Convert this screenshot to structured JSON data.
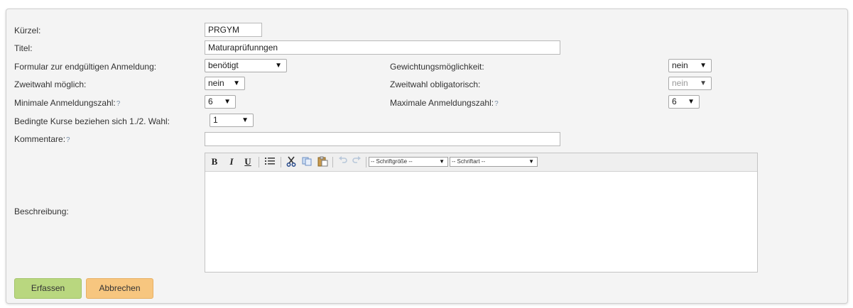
{
  "form": {
    "kuerzel": {
      "label": "Kürzel:",
      "value": "PRGYM"
    },
    "titel": {
      "label": "Titel:",
      "value": "Maturaprüfunngen"
    },
    "formular": {
      "label": "Formular zur endgültigen Anmeldung:",
      "value": "benötigt"
    },
    "gewichtung": {
      "label": "Gewichtungsmöglichkeit:",
      "value": "nein"
    },
    "zweitwahl": {
      "label": "Zweitwahl möglich:",
      "value": "nein"
    },
    "zweitwahl_obl": {
      "label": "Zweitwahl obligatorisch:",
      "value": "nein"
    },
    "min_anmeldung": {
      "label": "Minimale Anmeldungszahl:",
      "hint": "?",
      "value": "6"
    },
    "max_anmeldung": {
      "label": "Maximale Anmeldungszahl:",
      "hint": "?",
      "value": "6"
    },
    "bedingte": {
      "label": "Bedingte Kurse beziehen sich 1./2. Wahl:",
      "value": "1"
    },
    "kommentare": {
      "label": "Kommentare:",
      "hint": "?",
      "value": ""
    },
    "beschreibung": {
      "label": "Beschreibung:"
    }
  },
  "editor": {
    "bold": "B",
    "italic": "I",
    "underline": "U",
    "fontsize_select": "-- Schriftgröße --",
    "fontface_select": "-- Schriftart --"
  },
  "buttons": {
    "submit": "Erfassen",
    "cancel": "Abbrechen"
  },
  "colors": {
    "submit_bg": "#b9d77f",
    "cancel_bg": "#f7c67f",
    "panel_bg": "#f4f4f4"
  }
}
